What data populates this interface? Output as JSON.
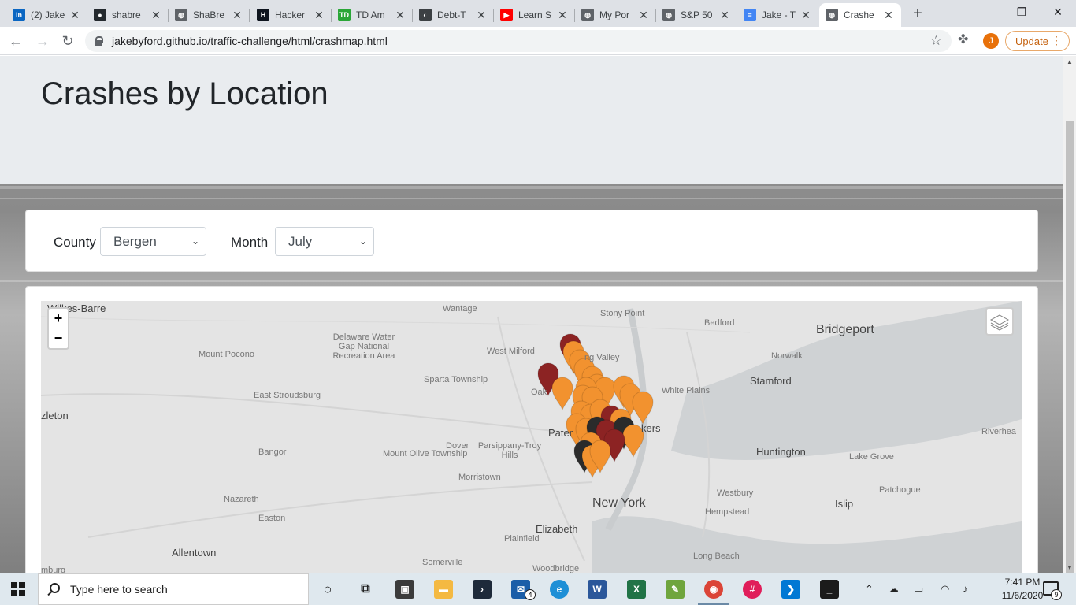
{
  "browser": {
    "tabs": [
      {
        "title": "(2) Jake",
        "icon": "linkedin-icon",
        "color": "#0a66c2",
        "glyph": "in"
      },
      {
        "title": "shabre",
        "icon": "github-icon",
        "color": "#24292e",
        "glyph": "●"
      },
      {
        "title": "ShaBre",
        "icon": "globe-icon",
        "color": "#5f6368",
        "glyph": "◍"
      },
      {
        "title": "Hacker",
        "icon": "hackerrank-icon",
        "color": "#0e141e",
        "glyph": "H"
      },
      {
        "title": "TD Am",
        "icon": "td-ameritrade-icon",
        "color": "#2aa637",
        "glyph": "TD"
      },
      {
        "title": "Debt-T",
        "icon": "debt-icon",
        "color": "#3c4043",
        "glyph": "◐"
      },
      {
        "title": "Learn S",
        "icon": "youtube-icon",
        "color": "#ff0000",
        "glyph": "▶"
      },
      {
        "title": "My Por",
        "icon": "globe-icon",
        "color": "#5f6368",
        "glyph": "◍"
      },
      {
        "title": "S&P 50",
        "icon": "globe-icon",
        "color": "#5f6368",
        "glyph": "◍"
      },
      {
        "title": "Jake - T",
        "icon": "google-docs-icon",
        "color": "#4285f4",
        "glyph": "≡"
      },
      {
        "title": "Crashe",
        "icon": "globe-icon",
        "color": "#5f6368",
        "glyph": "◍"
      }
    ],
    "url": "jakebyford.github.io/traffic-challenge/html/crashmap.html",
    "profile_initial": "J",
    "update_label": "Update"
  },
  "page": {
    "title": "Crashes by Location",
    "filters": {
      "county_label": "County",
      "county_value": "Bergen",
      "month_label": "Month",
      "month_value": "July"
    },
    "map": {
      "zoom_in": "+",
      "zoom_out": "−",
      "labels": [
        {
          "text": "Wilkes-Barre",
          "kind": "city"
        },
        {
          "text": "Wantage",
          "kind": "town"
        },
        {
          "text": "Stony Point",
          "kind": "town"
        },
        {
          "text": "Bedford",
          "kind": "town"
        },
        {
          "text": "Bridgeport",
          "kind": "big"
        },
        {
          "text": "Delaware Water Gap National Recreation Area",
          "kind": "town"
        },
        {
          "text": "Mount Pocono",
          "kind": "town"
        },
        {
          "text": "West Milford",
          "kind": "town"
        },
        {
          "text": "ng Valley",
          "kind": "town"
        },
        {
          "text": "Norwalk",
          "kind": "town"
        },
        {
          "text": "Sparta Township",
          "kind": "town"
        },
        {
          "text": "Oak",
          "kind": "town"
        },
        {
          "text": "White Plains",
          "kind": "town"
        },
        {
          "text": "Stamford",
          "kind": "city"
        },
        {
          "text": "East Stroudsburg",
          "kind": "town"
        },
        {
          "text": "zleton",
          "kind": "city"
        },
        {
          "text": "kers",
          "kind": "city"
        },
        {
          "text": "Pater",
          "kind": "city"
        },
        {
          "text": "Riverhea",
          "kind": "town"
        },
        {
          "text": "Dover",
          "kind": "town"
        },
        {
          "text": "Parsippany-Troy Hills",
          "kind": "town"
        },
        {
          "text": "Huntington",
          "kind": "city"
        },
        {
          "text": "Bangor",
          "kind": "town"
        },
        {
          "text": "Mount Olive Township",
          "kind": "town"
        },
        {
          "text": "Lake Grove",
          "kind": "town"
        },
        {
          "text": "Morristown",
          "kind": "town"
        },
        {
          "text": "Patchogue",
          "kind": "town"
        },
        {
          "text": "Nazareth",
          "kind": "town"
        },
        {
          "text": "New York",
          "kind": "big"
        },
        {
          "text": "Westbury",
          "kind": "town"
        },
        {
          "text": "Islip",
          "kind": "city"
        },
        {
          "text": "Easton",
          "kind": "town"
        },
        {
          "text": "Hempstead",
          "kind": "town"
        },
        {
          "text": "Elizabeth",
          "kind": "city"
        },
        {
          "text": "Plainfield",
          "kind": "town"
        },
        {
          "text": "Allentown",
          "kind": "city"
        },
        {
          "text": "Long Beach",
          "kind": "town"
        },
        {
          "text": "Somerville",
          "kind": "town"
        },
        {
          "text": "mburg",
          "kind": "town"
        },
        {
          "text": "Woodbridge",
          "kind": "town"
        }
      ],
      "marker_colors": {
        "minor": "#f2922f",
        "severe": "#8c2323",
        "fatal": "#2b2b2b"
      }
    }
  },
  "taskbar": {
    "search_placeholder": "Type here to search",
    "mail_badge": "4",
    "time": "7:41 PM",
    "date": "11/6/2020",
    "notification_count": "9"
  }
}
